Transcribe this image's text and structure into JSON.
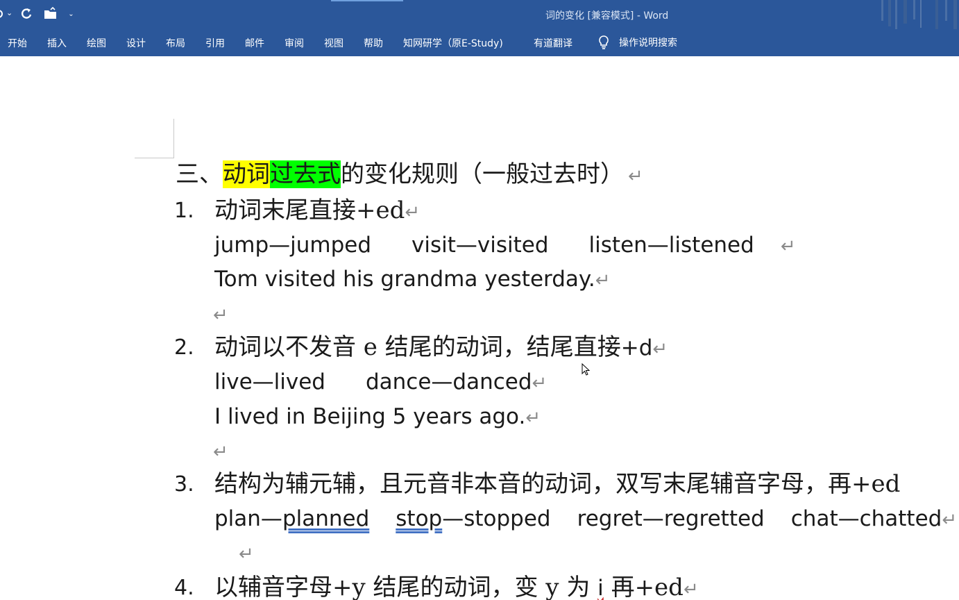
{
  "titlebar": {
    "title": "词的变化 [兼容模式]  -  Word",
    "dropdown_glyph": "⌄",
    "customize_glyph": "⌄"
  },
  "ribbon": {
    "tabs": [
      "开始",
      "插入",
      "绘图",
      "设计",
      "布局",
      "引用",
      "邮件",
      "审阅",
      "视图",
      "帮助",
      "知网研学（原E-Study)",
      "有道翻译"
    ],
    "tell_me": "操作说明搜索"
  },
  "doc": {
    "heading": {
      "prefix": "三、",
      "hl1": "动词",
      "hl2": "过去式",
      "rest": "的变化规则（一般过去时）"
    },
    "mark": "↵",
    "rules": [
      {
        "number": "1.",
        "title": "动词末尾直接+ed",
        "examples": [
          "jump—jumped",
          "visit—visited",
          "listen—listened"
        ],
        "sentence": "Tom visited his grandma yesterday."
      },
      {
        "number": "2.",
        "title_a": "动词以不发音 e  结尾的动词，结尾直接",
        "title_b": "+d",
        "examples": [
          "live—lived",
          "dance—danced"
        ],
        "sentence": "I lived in Beijing 5 years ago."
      },
      {
        "number": "3.",
        "title": "结构为辅元辅，且元音非本音的动词，双写末尾辅音字母，再+ed",
        "ex1_a": "plan—",
        "ex1_b": "planned",
        "ex2_a": "stop",
        "ex2_b": "—stopped",
        "ex3": "regret—regretted",
        "ex4": "chat—chatted"
      },
      {
        "number": "4.",
        "title_a": "以辅音字母+y 结尾的动词，变 y 为 ",
        "title_i": "i",
        "title_b": " 再+ed"
      }
    ]
  },
  "colors": {
    "ribbon": "#2b579a",
    "highlight_yellow": "#ffff00",
    "highlight_green": "#00ff00"
  }
}
